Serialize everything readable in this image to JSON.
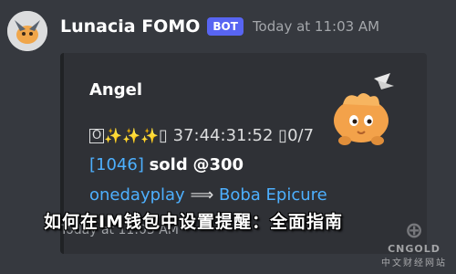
{
  "message": {
    "author": "Lunacia FOMO",
    "bot_badge": "BOT",
    "timestamp": "Today at 11:03 AM"
  },
  "embed": {
    "title": "Angel",
    "line1_box": "O",
    "line1_sparkles": "✨✨✨",
    "line1_stats": "37:44:31:52 ▯0/7",
    "line1_prefix": "▯",
    "line2_id": "[1046]",
    "line2_action": "sold",
    "line2_price": "@300",
    "line3_seller": "onedayplay",
    "line3_arrow": "⟹",
    "line3_buyer": "Boba Epicure",
    "footer": "Today at 11:03 AM"
  },
  "overlay_title": "如何在IM钱包中设置提醒：全面指南",
  "watermark": {
    "url": "CNGOLD",
    "cn": "中文财经网站"
  },
  "colors": {
    "background": "#36393f",
    "embed_bg": "#2f3136",
    "bot_badge": "#5865f2",
    "link_blue": "#4db0ff"
  }
}
